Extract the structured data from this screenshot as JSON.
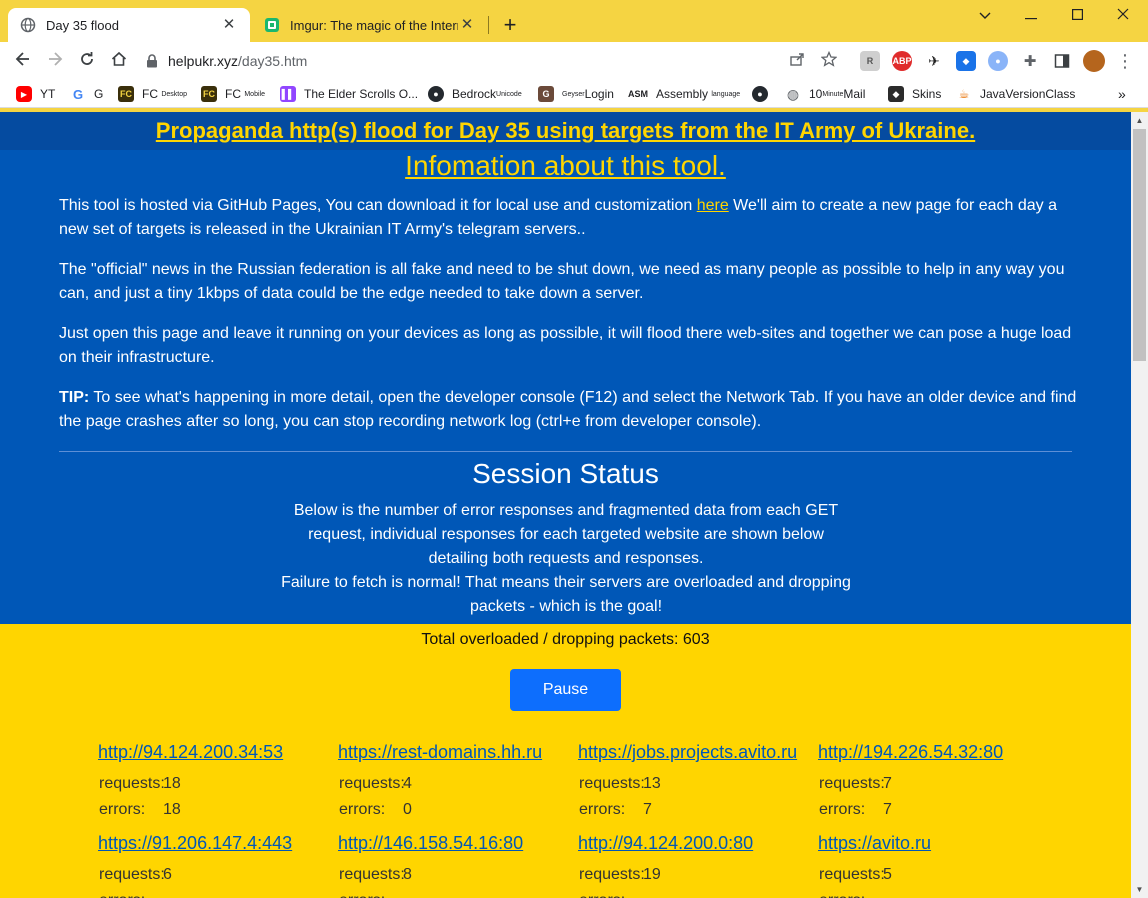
{
  "browser": {
    "tabs": [
      {
        "title": "Day 35 flood",
        "favicon": "globe-icon",
        "active": true
      },
      {
        "title": "Imgur: The magic of the Internet",
        "favicon": "imgur-icon",
        "active": false
      }
    ],
    "url_host": "helpukr.xyz",
    "url_path": "/day35.htm",
    "bookmarks": [
      {
        "label": "YT",
        "icon": "youtube-icon"
      },
      {
        "label": "G",
        "icon": "google-icon"
      },
      {
        "label": "FC",
        "sup": "Desktop",
        "icon": "fc-icon"
      },
      {
        "label": "FC",
        "sup": "Mobile",
        "icon": "fc-icon"
      },
      {
        "label": "The Elder Scrolls O...",
        "icon": "twitch-icon"
      },
      {
        "label": "Bedrock",
        "sup": "Unicode",
        "icon": "github-icon"
      },
      {
        "label": "Login",
        "pre": "Geyser",
        "icon": "geyser-icon"
      },
      {
        "label": "Assembly",
        "sup": "language",
        "icon": "asm-icon"
      },
      {
        "label": "",
        "icon": "github-icon"
      },
      {
        "label": "10",
        "sup": "Minute",
        "suffix": " Mail",
        "icon": "globe-icon"
      },
      {
        "label": "Skins",
        "icon": "cube-icon"
      },
      {
        "label": "JavaVersionClass",
        "icon": "java-icon"
      }
    ]
  },
  "page": {
    "banner": "Propaganda http(s) flood for Day 35 using targets from the IT Army of Ukraine.",
    "info_title": "Infomation about this tool.",
    "p1_before": "This tool is hosted via GitHub Pages, You can download it for local use and customization ",
    "p1_link": "here",
    "p1_after": " We'll aim to create a new page for each day a new set of targets is released in the Ukrainian IT Army's telegram servers..",
    "p2": "The \"official\" news in the Russian federation is all fake and need to be shut down, we need as many people as possible to help in any way you can, and just a tiny 1kbps of data could be the edge needed to take down a server.",
    "p3": "Just open this page and leave it running on your devices as long as possible, it will flood there web-sites and together we can pose a huge load on their infrastructure.",
    "tip_label": "TIP:",
    "tip_text": " To see what's happening in more detail, open the developer console (F12) and select the Network Tab. If you have an older device and find the page crashes after so long, you can stop recording network log (ctrl+e from developer console).",
    "session_title": "Session Status",
    "session_text_1": "Below is the number of error responses and fragmented data from each GET request, individual responses for each targeted website are shown below detailing both requests and responses.",
    "session_text_2": "Failure to fetch is normal! That means their servers are overloaded and dropping packets - which is the goal!",
    "total": "Total overloaded / dropping packets: 603",
    "pause_label": "Pause",
    "requests_label": "requests:",
    "errors_label": "errors:",
    "targets": [
      {
        "url": "http://94.124.200.34:53",
        "requests": "18",
        "errors": "18"
      },
      {
        "url": "https://rest-domains.hh.ru",
        "requests": "4",
        "errors": "0"
      },
      {
        "url": "https://jobs.projects.avito.ru",
        "requests": "13",
        "errors": "7"
      },
      {
        "url": "http://194.226.54.32:80",
        "requests": "7",
        "errors": "7"
      },
      {
        "url": "https://91.206.147.4:443",
        "requests": "6",
        "errors": ""
      },
      {
        "url": "http://146.158.54.16:80",
        "requests": "8",
        "errors": ""
      },
      {
        "url": "http://94.124.200.0:80",
        "requests": "19",
        "errors": ""
      },
      {
        "url": "https://avito.ru",
        "requests": "5",
        "errors": ""
      }
    ]
  }
}
